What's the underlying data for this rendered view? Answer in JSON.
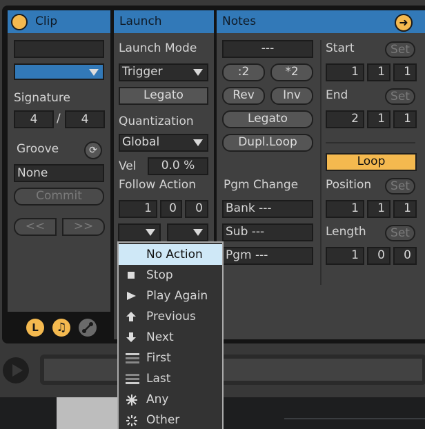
{
  "clip": {
    "title": "Clip",
    "name_value": "",
    "color_dropdown_value": "",
    "signature_label": "Signature",
    "signature_numerator": "4",
    "signature_separator": "/",
    "signature_denominator": "4",
    "groove_label": "Groove",
    "groove_value": "None",
    "commit_label": "Commit",
    "prev_label": "<<",
    "next_label": ">>",
    "footer_icons": [
      "launch-view-icon",
      "notes-view-icon",
      "envelopes-icon"
    ],
    "footer_letter": "L",
    "footer_note_glyph": "♫"
  },
  "launch": {
    "title": "Launch",
    "launch_mode_label": "Launch Mode",
    "launch_mode_value": "Trigger",
    "legato_label": "Legato",
    "quantization_label": "Quantization",
    "quantization_value": "Global",
    "vel_label": "Vel",
    "vel_value": "0.0 %",
    "follow_action_label": "Follow Action",
    "follow_time": [
      "1",
      "0",
      "0"
    ],
    "follow_action_a": "",
    "follow_action_b": ""
  },
  "notes": {
    "title": "Notes",
    "transpose_value": "---",
    "half_label": ":2",
    "double_label": "*2",
    "rev_label": "Rev",
    "inv_label": "Inv",
    "legato_label": "Legato",
    "dupl_loop_label": "Dupl.Loop",
    "pgm_change_label": "Pgm Change",
    "bank_value": "Bank ---",
    "sub_value": "Sub ---",
    "pgm_value": "Pgm ---",
    "start_label": "Start",
    "start_values": [
      "1",
      "1",
      "1"
    ],
    "end_label": "End",
    "end_values": [
      "2",
      "1",
      "1"
    ],
    "set_label": "Set",
    "loop_label": "Loop",
    "position_label": "Position",
    "position_values": [
      "1",
      "1",
      "1"
    ],
    "length_label": "Length",
    "length_values": [
      "1",
      "0",
      "0"
    ]
  },
  "follow_menu": {
    "selected": "No Action",
    "items": [
      {
        "label": "No Action",
        "icon": "none"
      },
      {
        "label": "Stop",
        "icon": "stop-icon",
        "glyph": "■"
      },
      {
        "label": "Play Again",
        "icon": "play-icon",
        "glyph": "▶"
      },
      {
        "label": "Previous",
        "icon": "arrow-up-icon",
        "glyph": "🡅"
      },
      {
        "label": "Next",
        "icon": "arrow-down-icon",
        "glyph": "🡇"
      },
      {
        "label": "First",
        "icon": "first-icon",
        "glyph": "≡"
      },
      {
        "label": "Last",
        "icon": "last-icon",
        "glyph": "≡"
      },
      {
        "label": "Any",
        "icon": "asterisk-icon",
        "glyph": "✳"
      },
      {
        "label": "Other",
        "icon": "sparkle-icon",
        "glyph": "⁂"
      }
    ]
  },
  "colors": {
    "header_blue": "#3279b8",
    "accent_orange": "#f4b94f",
    "menu_selected": "#cfe8f7"
  }
}
